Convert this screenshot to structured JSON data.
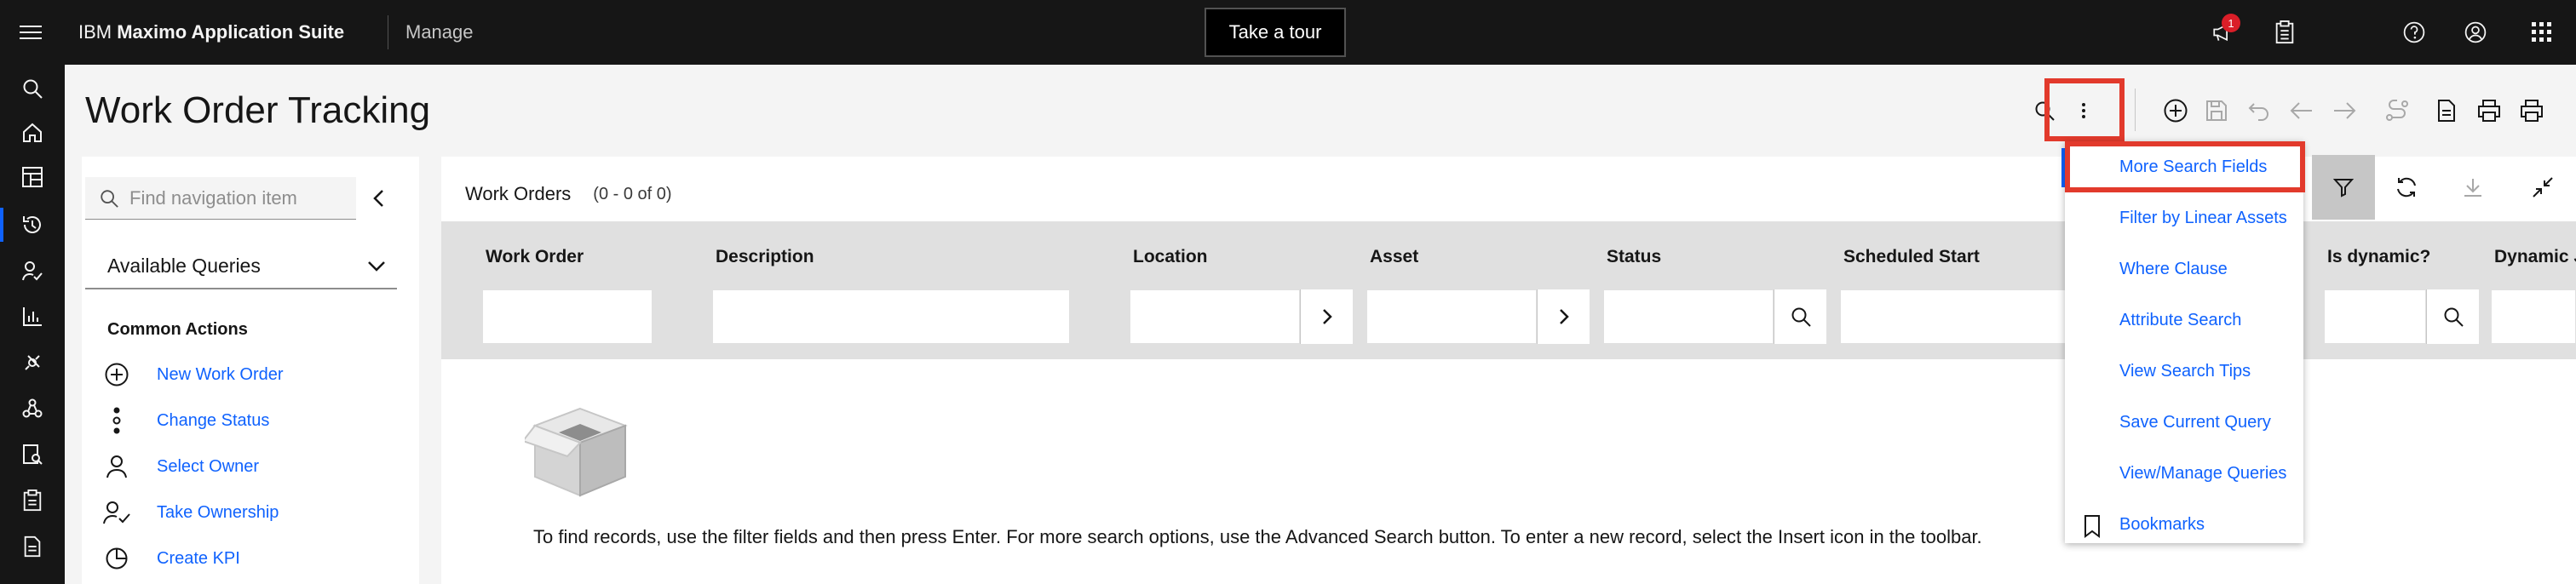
{
  "header": {
    "brand_prefix": "IBM ",
    "brand_bold": "Maximo Application Suite",
    "app_name": "Manage",
    "tour_label": "Take a tour",
    "notification_count": "1",
    "icons": [
      "menu-icon",
      "megaphone-icon",
      "clipboard-icon",
      "help-icon",
      "user-icon",
      "app-switcher-icon"
    ]
  },
  "rail": {
    "icons": [
      "search-icon",
      "home-icon",
      "dashboard-icon",
      "history-icon",
      "user-check-icon",
      "chart-icon",
      "satellite-icon",
      "network-icon",
      "inspection-icon",
      "clipboard-icon",
      "document-icon"
    ],
    "active_index": 3
  },
  "page": {
    "title": "Work Order Tracking"
  },
  "toolbar": {
    "icons": [
      "search-icon",
      "overflow-menu-icon",
      "add-icon",
      "save-icon",
      "undo-icon",
      "back-icon",
      "forward-icon",
      "route-icon",
      "document-icon",
      "print-icon",
      "print-icon"
    ]
  },
  "sidebar": {
    "search_placeholder": "Find navigation item",
    "queries_label": "Available Queries",
    "common_actions_title": "Common Actions",
    "actions": [
      {
        "label": "New Work Order",
        "icon": "add-circle-icon"
      },
      {
        "label": "Change Status",
        "icon": "status-icon"
      },
      {
        "label": "Select Owner",
        "icon": "user-icon"
      },
      {
        "label": "Take Ownership",
        "icon": "user-check-icon"
      },
      {
        "label": "Create KPI",
        "icon": "pie-chart-icon"
      }
    ]
  },
  "work_orders": {
    "title": "Work Orders",
    "count": "(0 - 0 of 0)",
    "columns": [
      "Work Order",
      "Description",
      "Location",
      "Asset",
      "Status",
      "Scheduled Start",
      "Is dynamic?",
      "Dynamic J"
    ],
    "empty_message": "To find records, use the filter fields and then press Enter. For more search options, use the Advanced Search button. To enter a new record, select the Insert icon in the toolbar."
  },
  "menu": {
    "items": [
      "More Search Fields",
      "Filter by Linear Assets",
      "Where Clause",
      "Attribute Search",
      "View Search Tips",
      "Save Current Query",
      "View/Manage Queries",
      "Bookmarks"
    ]
  },
  "colors": {
    "header_bg": "#161616",
    "link": "#0f62fe",
    "highlight": "#e23a2c"
  }
}
